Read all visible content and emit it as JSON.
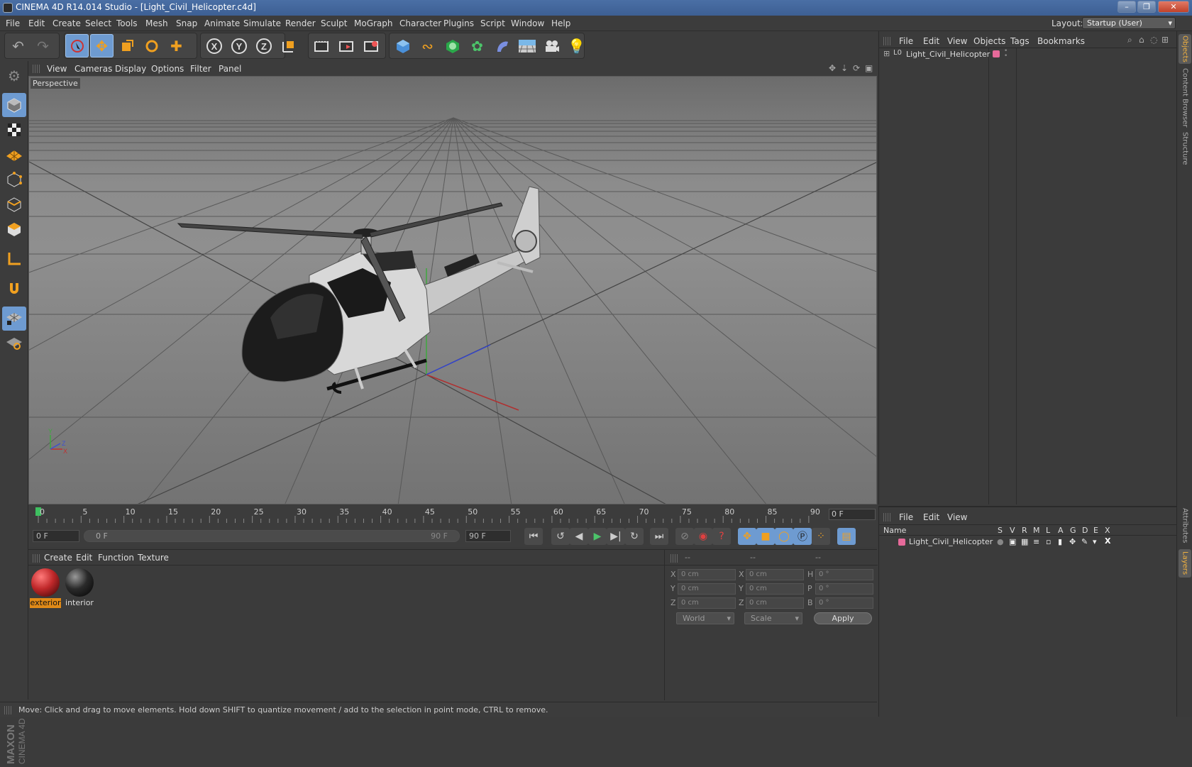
{
  "window": {
    "title": "CINEMA 4D R14.014 Studio - [Light_Civil_Helicopter.c4d]",
    "controls": [
      "–",
      "❐",
      "✕"
    ]
  },
  "menubar": {
    "items": [
      "File",
      "Edit",
      "Create",
      "Select",
      "Tools",
      "Mesh",
      "Snap",
      "Animate",
      "Simulate",
      "Render",
      "Sculpt",
      "MoGraph",
      "Character",
      "Plugins",
      "Script",
      "Window",
      "Help"
    ],
    "layout_label": "Layout:",
    "layout_value": "Startup (User)"
  },
  "toolbar": {
    "axis_x": "X",
    "axis_y": "Y",
    "axis_z": "Z"
  },
  "viewport": {
    "menu": [
      "View",
      "Cameras",
      "Display",
      "Options",
      "Filter",
      "Panel"
    ],
    "label": "Perspective",
    "axis_labels": {
      "y": "Y",
      "z": "Z",
      "x": "X"
    }
  },
  "timeline": {
    "ticks": [
      "0",
      "5",
      "10",
      "15",
      "20",
      "25",
      "30",
      "35",
      "40",
      "45",
      "50",
      "55",
      "60",
      "65",
      "70",
      "75",
      "80",
      "85",
      "90"
    ],
    "current_frame_box": "0 F"
  },
  "transport": {
    "start_field": "0 F",
    "range_start": "0 F",
    "range_end": "90 F",
    "end_field": "90 F"
  },
  "material_manager": {
    "menu": [
      "Create",
      "Edit",
      "Function",
      "Texture"
    ],
    "materials": [
      {
        "name": "exterior",
        "selected": true,
        "color": "#c0282a"
      },
      {
        "name": "interior",
        "selected": false,
        "color": "#2a2a2a"
      }
    ]
  },
  "coordinates": {
    "headers": [
      "--",
      "--",
      "--"
    ],
    "rows": [
      {
        "pos_label": "X",
        "pos": "0 cm",
        "size_label": "X",
        "size": "0 cm",
        "rot_label": "H",
        "rot": "0 °"
      },
      {
        "pos_label": "Y",
        "pos": "0 cm",
        "size_label": "Y",
        "size": "0 cm",
        "rot_label": "P",
        "rot": "0 °"
      },
      {
        "pos_label": "Z",
        "pos": "0 cm",
        "size_label": "Z",
        "size": "0 cm",
        "rot_label": "B",
        "rot": "0 °"
      }
    ],
    "mode": "World",
    "size_mode": "Scale",
    "apply": "Apply"
  },
  "object_manager": {
    "menu": [
      "File",
      "Edit",
      "View",
      "Objects",
      "Tags",
      "Bookmarks"
    ],
    "objects": [
      {
        "name": "Light_Civil_Helicopter",
        "color": "#e66a9a"
      }
    ]
  },
  "layer_manager": {
    "menu": [
      "File",
      "Edit",
      "View"
    ],
    "columns": [
      "Name",
      "S",
      "V",
      "R",
      "M",
      "L",
      "A",
      "G",
      "D",
      "E",
      "X"
    ],
    "layers": [
      {
        "name": "Light_Civil_Helicopter",
        "color": "#e66a9a"
      }
    ]
  },
  "side_tabs": [
    "Objects",
    "Content Browser",
    "Structure",
    "Attributes",
    "Layers"
  ],
  "status": "Move: Click and drag to move elements. Hold down SHIFT to quantize movement / add to the selection in point mode, CTRL to remove.",
  "branding": {
    "line1": "MAXON",
    "line2": "CINEMA 4D"
  }
}
